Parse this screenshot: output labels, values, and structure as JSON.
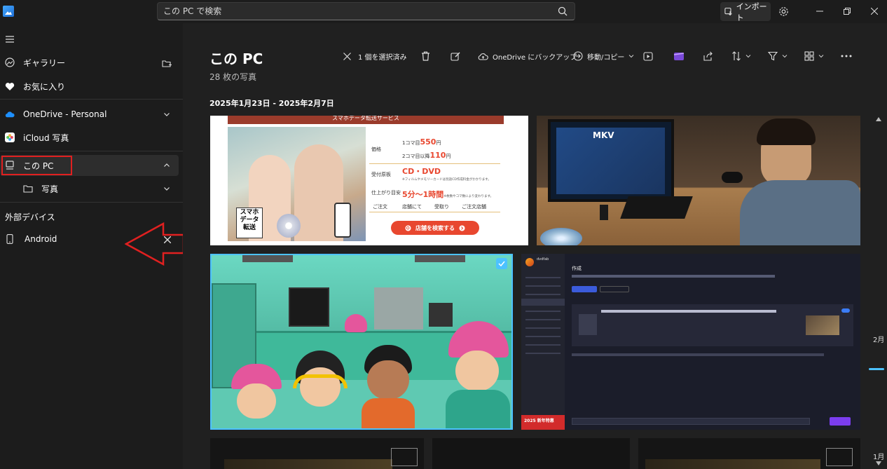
{
  "titlebar": {
    "search_placeholder": "この PC で検索",
    "import_label": "インポート"
  },
  "sidebar": {
    "items": [
      {
        "label": "ギャラリー",
        "icon": "gallery-icon"
      },
      {
        "label": "お気に入り",
        "icon": "heart-icon"
      },
      {
        "label": "OneDrive - Personal",
        "icon": "onedrive-icon"
      },
      {
        "label": "iCloud 写真",
        "icon": "icloud-photos-icon"
      },
      {
        "label": "この PC",
        "icon": "pc-icon"
      },
      {
        "label": "写真",
        "icon": "folder-icon"
      }
    ],
    "external_header": "外部デバイス",
    "device": {
      "label": "Android",
      "icon": "phone-icon"
    }
  },
  "main": {
    "title": "この PC",
    "subtitle": "28 枚の写真",
    "toolbar": {
      "selected": "1 個を選択済み",
      "onedrive_backup": "OneDrive にバックアップ",
      "move_copy": "移動/コピー"
    },
    "date_header": "2025年1月23日 - 2025年2月7日"
  },
  "photo1": {
    "banner": "スマホデータ転送サービス",
    "label_price": "価格",
    "price1_pre": "1コマ目",
    "price1": "550",
    "price_unit": "円",
    "price2_pre": "2コマ目以降",
    "price2": "110",
    "label_media": "受付原板",
    "media": "CD・DVD",
    "media_note": "※フィルムやメモリーカードは別途CD作成料金がかかります。",
    "label_time": "仕上がり目安",
    "time": "5分〜1時間",
    "time_note": "※枚数やコマ数により変わります。",
    "label_order": "ご注文",
    "order_cols": [
      "店舗にて",
      "受取り",
      "ご注文店舗"
    ],
    "cta": "店舗を検索する",
    "photo_caption": "スマホ データ 転送"
  },
  "photo2": {
    "screen_text": "MKV"
  },
  "photo4": {
    "app_name": "dvdfab",
    "heading": "作成",
    "badge": "2025 新年特惠"
  },
  "timeline": {
    "month1": "2月",
    "month2": "1月"
  },
  "colors": {
    "accent": "#4cc2ff",
    "redbox": "#e02020",
    "arrow": "#e02020",
    "promo_red": "#e8472f"
  }
}
